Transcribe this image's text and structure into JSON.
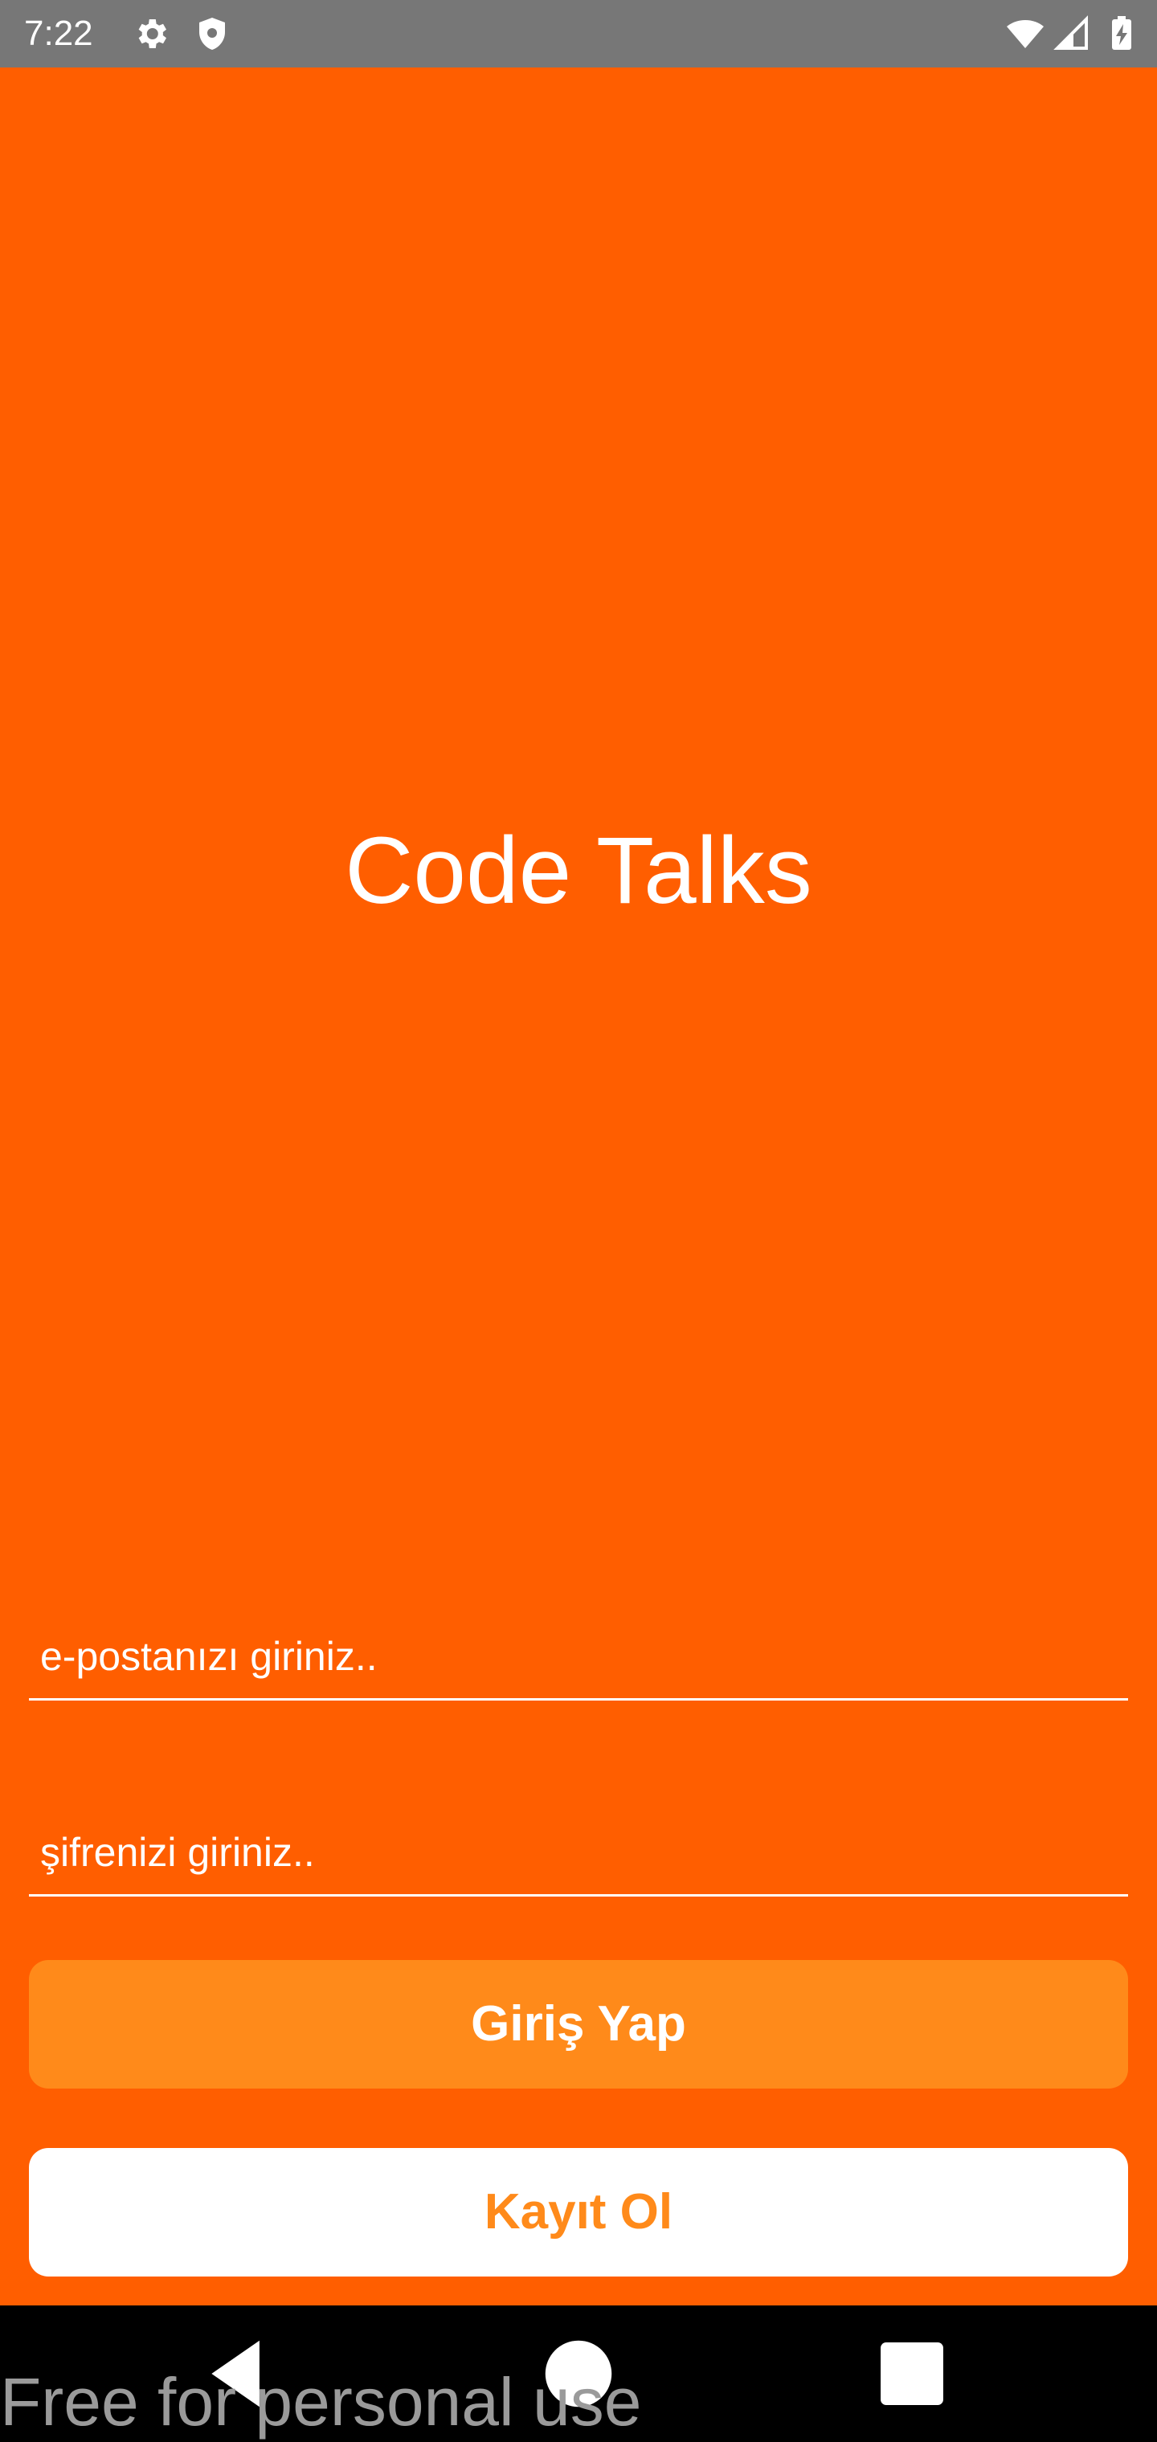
{
  "status_bar": {
    "time": "7:22",
    "left_icons": [
      "gear-icon",
      "shield-icon"
    ],
    "right_icons": [
      "wifi-icon",
      "cell-signal-icon",
      "battery-charging-icon"
    ]
  },
  "app": {
    "title": "Code Talks",
    "email": {
      "placeholder": "e-postanızı giriniz..",
      "value": ""
    },
    "password": {
      "placeholder": "şifrenizi giriniz..",
      "value": ""
    },
    "login_label": "Giriş Yap",
    "register_label": "Kayıt Ol"
  },
  "nav_bar": {
    "buttons": [
      "back-icon",
      "home-icon",
      "recents-icon"
    ]
  },
  "watermark": "Free for personal use",
  "colors": {
    "background": "#ff5e00",
    "status_bar": "#777777",
    "login_button": "#ff8a1a",
    "register_button": "#ffffff",
    "register_text": "#ff8a1a",
    "nav_bar": "#000000"
  }
}
